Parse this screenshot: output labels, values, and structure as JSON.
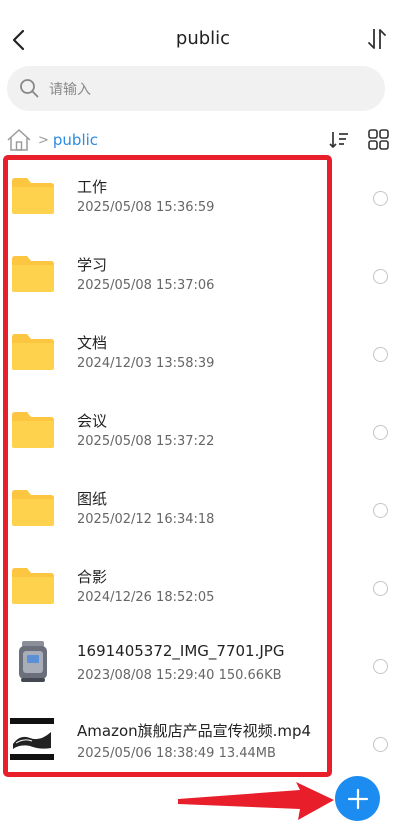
{
  "header": {
    "title": "public",
    "back_icon": "chevron-left-icon",
    "sort_icon": "sort-arrows-icon"
  },
  "search": {
    "placeholder": "请输入",
    "icon": "search-icon"
  },
  "breadcrumb": {
    "home_icon": "home-icon",
    "separator": ">",
    "current": "public"
  },
  "toolbar": {
    "sort_icon": "sort-list-icon",
    "view_icon": "grid-view-icon"
  },
  "files": [
    {
      "name": "工作",
      "meta": "2025/05/08 15:36:59",
      "type": "folder"
    },
    {
      "name": "学习",
      "meta": "2025/05/08 15:37:06",
      "type": "folder"
    },
    {
      "name": "文档",
      "meta": "2024/12/03 13:58:39",
      "type": "folder"
    },
    {
      "name": "会议",
      "meta": "2025/05/08 15:37:22",
      "type": "folder"
    },
    {
      "name": "图纸",
      "meta": "2025/02/12 16:34:18",
      "type": "folder"
    },
    {
      "name": "合影",
      "meta": "2024/12/26 18:52:05",
      "type": "folder"
    },
    {
      "name": "1691405372_IMG_7701.JPG",
      "meta": "2023/08/08 15:29:40 150.66KB",
      "type": "image"
    },
    {
      "name": "Amazon旗舰店产品宣传视频.mp4",
      "meta": "2025/05/06 18:38:49 13.44MB",
      "type": "video"
    }
  ],
  "fab": {
    "icon": "plus-icon"
  },
  "colors": {
    "accent": "#1d8cf0",
    "folder": "#fdc640",
    "annotation": "#e81e2b",
    "breadcrumb": "#2d8be0"
  }
}
